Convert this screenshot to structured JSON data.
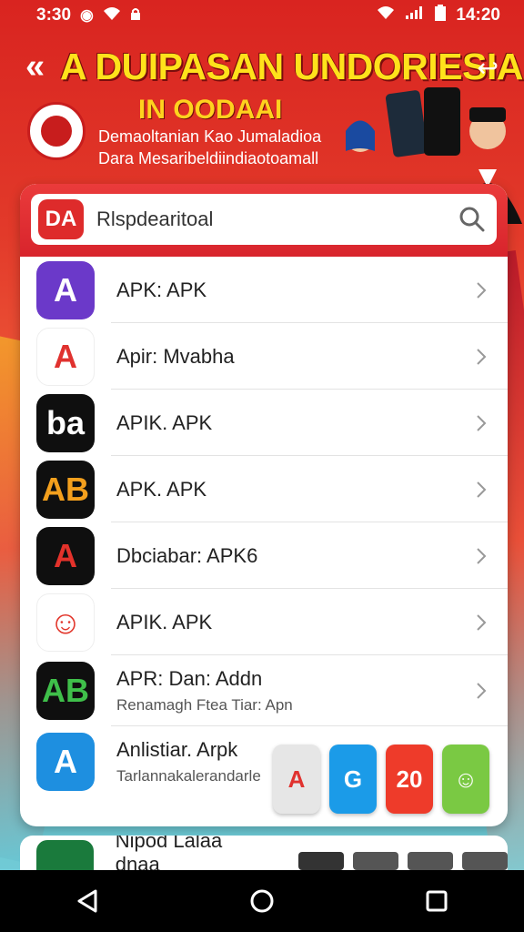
{
  "status_bar": {
    "left_time": "3:30",
    "right_time": "14:20"
  },
  "banner": {
    "back_icon": "back-arrow-icon",
    "title": "A DUIPASAN UNDORIESIA",
    "subtitle": "IN OODAAI",
    "line1": "Demaoltanian Kao Jumaladioa",
    "line2": "Dara Mesaribeldiindiaotoamall"
  },
  "search": {
    "logo_text": "DA",
    "value": "Rlspdearitoal"
  },
  "apps": [
    {
      "name": "APK: APK",
      "desc": "",
      "icon_bg": "#6b39c9",
      "icon_text": "A",
      "icon_color": "#ffffff"
    },
    {
      "name": "Apir: Mvabha",
      "desc": "",
      "icon_bg": "#ffffff",
      "icon_text": "A",
      "icon_color": "#e0322f"
    },
    {
      "name": "APIK. APK",
      "desc": "",
      "icon_bg": "#0f0f0f",
      "icon_text": "ba",
      "icon_color": "#ffffff"
    },
    {
      "name": "APK. APK",
      "desc": "",
      "icon_bg": "#0f0f0f",
      "icon_text": "AB",
      "icon_color": "#f4a01d"
    },
    {
      "name": "Dbciabar: APK6",
      "desc": "",
      "icon_bg": "#0f0f0f",
      "icon_text": "A",
      "icon_color": "#e3322b"
    },
    {
      "name": "APIK. APK",
      "desc": "",
      "icon_bg": "#ffffff",
      "icon_text": "☺",
      "icon_color": "#e2362b"
    },
    {
      "name": "APR: Dan: Addn",
      "desc": "Renamagh Ftea Tiar: Apn",
      "icon_bg": "#0f0f0f",
      "icon_text": "AB",
      "icon_color": "#3fbf4a"
    },
    {
      "name": "Anlistiar. Arpk",
      "desc": "Tarlannakalerandarle",
      "icon_bg": "#1e8fe0",
      "icon_text": "A",
      "icon_color": "#ffffff"
    }
  ],
  "floating_icons": [
    {
      "text": "A",
      "bg": "#e6e6e6",
      "color": "#e0322f"
    },
    {
      "text": "G",
      "bg": "#1b9be8",
      "color": "#ffffff"
    },
    {
      "text": "20",
      "bg": "#ee3b2a",
      "color": "#ffffff"
    },
    {
      "text": "☺",
      "bg": "#7ac943",
      "color": "#ffffff"
    }
  ],
  "partial_row": {
    "name": "Nipod Lalaa dnaa"
  },
  "colors": {
    "accent": "#d92420",
    "card": "#ffffff"
  }
}
